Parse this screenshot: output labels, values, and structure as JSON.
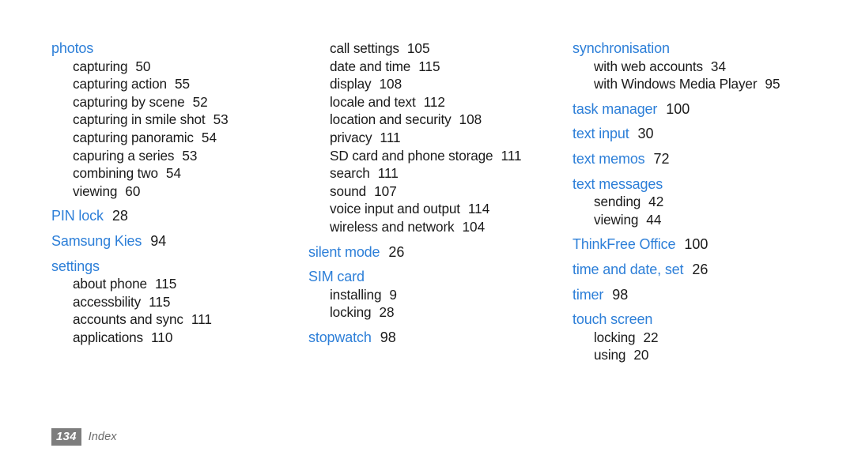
{
  "document": {
    "page_number": "134",
    "section_label": "Index",
    "accent_color": "#2d7fd8",
    "text_color": "#1a1a1a",
    "footer_badge_color": "#7d7d7d",
    "background_color": "#ffffff"
  },
  "columns": [
    {
      "groups": [
        {
          "heading": {
            "label": "photos",
            "page": ""
          },
          "entries": [
            {
              "label": "capturing",
              "page": "50"
            },
            {
              "label": "capturing action",
              "page": "55"
            },
            {
              "label": "capturing by scene",
              "page": "52"
            },
            {
              "label": "capturing in smile shot",
              "page": "53"
            },
            {
              "label": "capturing panoramic",
              "page": "54"
            },
            {
              "label": "capuring a series",
              "page": "53"
            },
            {
              "label": "combining two",
              "page": "54"
            },
            {
              "label": "viewing",
              "page": "60"
            }
          ]
        },
        {
          "heading": {
            "label": "PIN lock",
            "page": "28"
          },
          "entries": []
        },
        {
          "heading": {
            "label": "Samsung Kies",
            "page": "94"
          },
          "entries": []
        },
        {
          "heading": {
            "label": "settings",
            "page": ""
          },
          "entries": [
            {
              "label": "about phone",
              "page": "115"
            },
            {
              "label": "accessbility",
              "page": "115"
            },
            {
              "label": "accounts and sync",
              "page": "111"
            },
            {
              "label": "applications",
              "page": "110"
            }
          ]
        }
      ]
    },
    {
      "groups": [
        {
          "heading": null,
          "entries": [
            {
              "label": "call settings",
              "page": "105"
            },
            {
              "label": "date and time",
              "page": "115"
            },
            {
              "label": "display",
              "page": "108"
            },
            {
              "label": "locale and text",
              "page": "112"
            },
            {
              "label": "location and security",
              "page": "108"
            },
            {
              "label": "privacy",
              "page": "111"
            },
            {
              "label": "SD card and phone storage",
              "page": "111"
            },
            {
              "label": "search",
              "page": "111"
            },
            {
              "label": "sound",
              "page": "107"
            },
            {
              "label": "voice input and output",
              "page": "114"
            },
            {
              "label": "wireless and network",
              "page": "104"
            }
          ]
        },
        {
          "heading": {
            "label": "silent mode",
            "page": "26"
          },
          "entries": []
        },
        {
          "heading": {
            "label": "SIM card",
            "page": ""
          },
          "entries": [
            {
              "label": "installing",
              "page": "9"
            },
            {
              "label": "locking",
              "page": "28"
            }
          ]
        },
        {
          "heading": {
            "label": "stopwatch",
            "page": "98"
          },
          "entries": []
        }
      ]
    },
    {
      "groups": [
        {
          "heading": {
            "label": "synchronisation",
            "page": ""
          },
          "entries": [
            {
              "label": "with web accounts",
              "page": "34"
            },
            {
              "label": "with Windows Media Player",
              "page": "95"
            }
          ]
        },
        {
          "heading": {
            "label": "task manager",
            "page": "100"
          },
          "entries": []
        },
        {
          "heading": {
            "label": "text input",
            "page": "30"
          },
          "entries": []
        },
        {
          "heading": {
            "label": "text memos",
            "page": "72"
          },
          "entries": []
        },
        {
          "heading": {
            "label": "text messages",
            "page": ""
          },
          "entries": [
            {
              "label": "sending",
              "page": "42"
            },
            {
              "label": "viewing",
              "page": "44"
            }
          ]
        },
        {
          "heading": {
            "label": "ThinkFree Office",
            "page": "100"
          },
          "entries": []
        },
        {
          "heading": {
            "label": "time and date, set",
            "page": "26"
          },
          "entries": []
        },
        {
          "heading": {
            "label": "timer",
            "page": "98"
          },
          "entries": []
        },
        {
          "heading": {
            "label": "touch screen",
            "page": ""
          },
          "entries": [
            {
              "label": "locking",
              "page": "22"
            },
            {
              "label": "using",
              "page": "20"
            }
          ]
        }
      ]
    }
  ]
}
